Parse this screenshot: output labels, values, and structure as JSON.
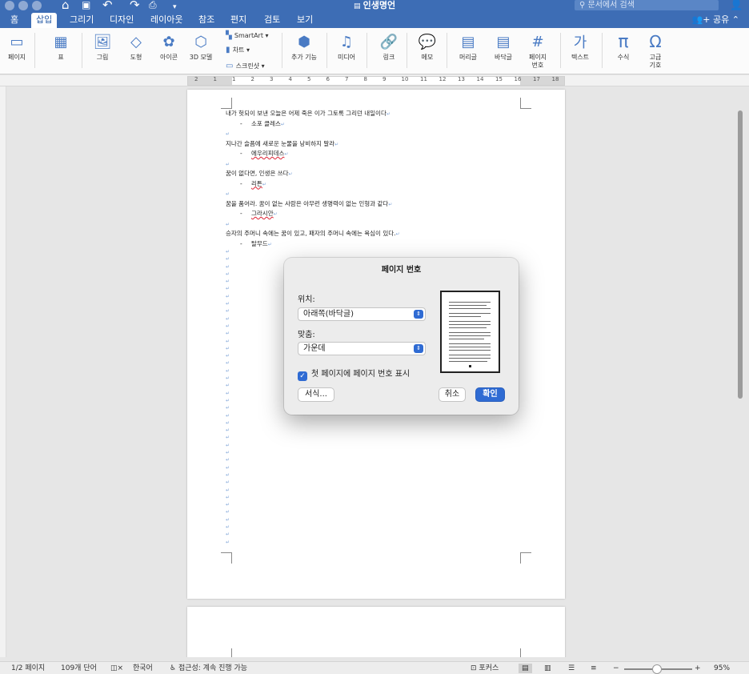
{
  "titlebar": {
    "doc_title": "인생명언",
    "search_placeholder": "문서에서 검색",
    "icons": [
      "home-icon",
      "save-icon",
      "undo-icon",
      "redo-icon",
      "print-icon",
      "customize-icon"
    ]
  },
  "tabs": [
    {
      "label": "홈"
    },
    {
      "label": "삽입",
      "active": true
    },
    {
      "label": "그리기"
    },
    {
      "label": "디자인"
    },
    {
      "label": "레이아웃"
    },
    {
      "label": "참조"
    },
    {
      "label": "편지"
    },
    {
      "label": "검토"
    },
    {
      "label": "보기"
    }
  ],
  "share_label": "공유",
  "ribbon": {
    "page": "페이지",
    "table": "표",
    "picture": "그림",
    "shape": "도형",
    "icons": "아이콘",
    "model3d": "3D 모델",
    "smartart": "SmartArt",
    "chart": "차트",
    "screenshot": "스크린샷",
    "addins": "추가 기능",
    "media": "미디어",
    "link": "링크",
    "comment": "메모",
    "header": "머리글",
    "footer": "바닥글",
    "page_number_1": "페이지",
    "page_number_2": "번호",
    "text": "텍스트",
    "equation": "수식",
    "symbol_1": "고급",
    "symbol_2": "기호"
  },
  "ruler_numbers": [
    "2",
    "1",
    "1",
    "2",
    "3",
    "4",
    "5",
    "6",
    "7",
    "8",
    "9",
    "10",
    "11",
    "12",
    "13",
    "14",
    "15",
    "16",
    "17",
    "18"
  ],
  "document": {
    "quotes": [
      {
        "text": "내가 헛되이 보낸 오늘은 어제 죽은 이가 그토록 그리던 내일이다",
        "author": "소포 클레스"
      },
      {
        "text": "지나간 슬픔에 새로운 눈물을 낭비하지 말라",
        "author": "에우리피데스"
      },
      {
        "text": "꿈이 없다면, 인생은 쓰다",
        "author": "리튼"
      },
      {
        "text": "꿈을 품어라. 꿈이 없는 사람은 아무런 생명력이 없는 인형과 같다",
        "author": "그라시안"
      },
      {
        "text": "승자의 주머니 속에는 꿈이 있고, 패자의 주머니 속에는 욕심이 있다.",
        "author": "탈무드"
      }
    ]
  },
  "dialog": {
    "title": "페이지 번호",
    "position_label": "위치:",
    "position_value": "아래쪽(바닥글)",
    "alignment_label": "맞춤:",
    "alignment_value": "가운데",
    "show_first_page_label": "첫 페이지에 페이지 번호 표시",
    "show_first_page_checked": true,
    "format_button": "서식...",
    "cancel_button": "취소",
    "ok_button": "확인"
  },
  "statusbar": {
    "page": "1/2 페이지",
    "words": "109개 단어",
    "language": "한국어",
    "accessibility": "접근성: 계속 진행 가능",
    "focus": "포커스",
    "zoom_minus": "−",
    "zoom_plus": "+",
    "zoom_level": "95%"
  },
  "colors": {
    "titlebar": "#3d6db5",
    "accent": "#2f6bd3"
  }
}
